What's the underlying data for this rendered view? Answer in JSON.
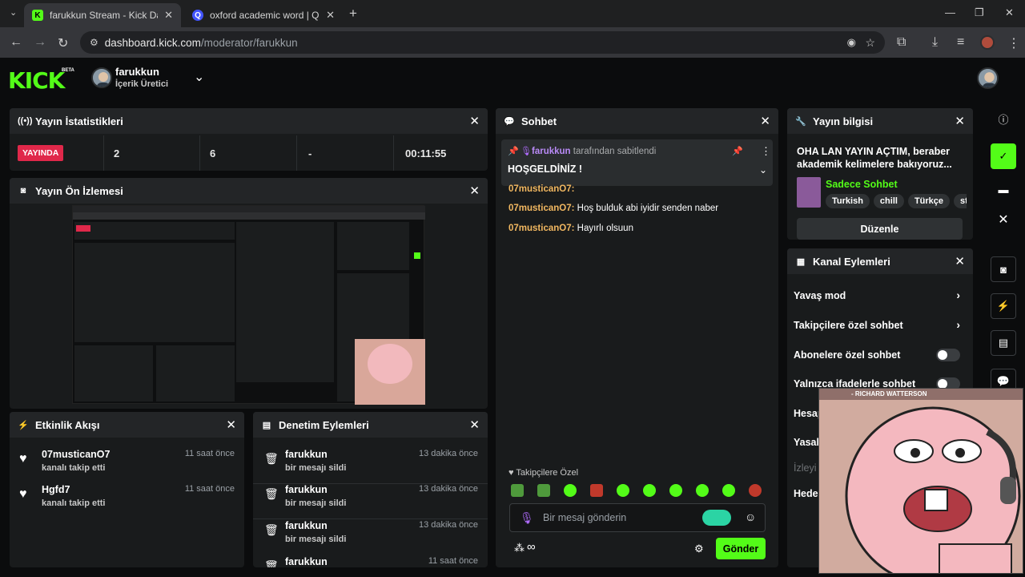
{
  "browser": {
    "tabs": [
      {
        "label": "farukkun Stream - Kick Dashbo",
        "favicon": "K"
      },
      {
        "label": "oxford academic word | Quizlet",
        "favicon": "Q"
      }
    ],
    "url_host": "dashboard.kick.com",
    "url_path": "/moderator/farukkun"
  },
  "header": {
    "logo": "KICK",
    "beta": "BETA",
    "user_name": "farukkun",
    "user_role": "İçerik Üretici"
  },
  "stats": {
    "title": "Yayın İstatistikleri",
    "live_badge": "YAYINDA",
    "viewers": "2",
    "followers": "6",
    "dash": "-",
    "uptime": "00:11:55"
  },
  "preview": {
    "title": "Yayın Ön İzlemesi"
  },
  "activity": {
    "title": "Etkinlik Akışı",
    "items": [
      {
        "name": "07musticanO7",
        "sub": "kanalı takip etti",
        "time": "11 saat önce"
      },
      {
        "name": "Hgfd7",
        "sub": "kanalı takip etti",
        "time": "11 saat önce"
      }
    ]
  },
  "moderation": {
    "title": "Denetim Eylemleri",
    "items": [
      {
        "name": "farukkun",
        "sub": "bir mesajı sildi",
        "time": "13 dakika önce"
      },
      {
        "name": "farukkun",
        "sub": "bir mesajı sildi",
        "time": "13 dakika önce"
      },
      {
        "name": "farukkun",
        "sub": "bir mesajı sildi",
        "time": "13 dakika önce"
      },
      {
        "name": "farukkun",
        "sub": "",
        "time": "11 saat önce"
      }
    ]
  },
  "chat": {
    "title": "Sohbet",
    "pinned_user": "farukkun",
    "pinned_suffix": "tarafından sabitlendi",
    "pinned_message": "HOŞGELDİNİZ !",
    "messages": [
      {
        "user": "07musticanO7:",
        "text": ""
      },
      {
        "user": "07musticanO7:",
        "text": "Hoş bulduk abi iyidir senden naber"
      },
      {
        "user": "07musticanO7:",
        "text": "Hayırlı olsuun"
      }
    ],
    "followers_only": "Takipçilere Özel",
    "placeholder": "Bir mesaj gönderin",
    "send": "Gönder"
  },
  "stream_info": {
    "title": "Yayın bilgisi",
    "stream_title": "OHA LAN YAYIN AÇTIM, beraber akademik kelimelere bakıyoruz...",
    "category": "Sadece Sohbet",
    "tags": [
      "Turkish",
      "chill",
      "Türkçe",
      "stud"
    ],
    "edit": "Düzenle"
  },
  "channel_actions": {
    "title": "Kanal Eylemleri",
    "rows": [
      {
        "label": "Yavaş mod"
      },
      {
        "label": "Takipçilere özel sohbet"
      },
      {
        "label": "Abonelere özel sohbet"
      },
      {
        "label": "Yalnızca ifadelerle sohbet"
      },
      {
        "label": "Hesap"
      },
      {
        "label": "Yasak"
      },
      {
        "label": "İzleyi"
      },
      {
        "label": "Hede"
      }
    ]
  },
  "overlay": {
    "caption": "- RICHARD WATTERSON"
  },
  "colors": {
    "accent": "#53fc18",
    "live": "#e0284a",
    "username": "#f2b861"
  }
}
